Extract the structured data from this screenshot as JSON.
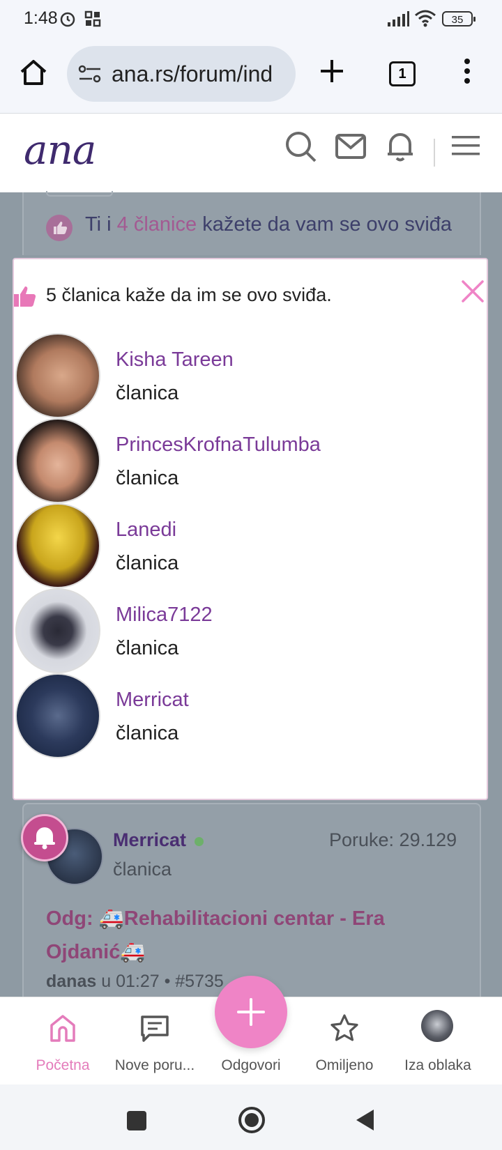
{
  "status_bar": {
    "time": "1:48",
    "battery": "35"
  },
  "browser": {
    "url": "ana.rs/forum/ind",
    "tab_count": "1"
  },
  "site": {
    "logo": "ana"
  },
  "background_post": {
    "like_prefix": "Ti i",
    "like_members": "4 članice",
    "like_suffix": "kažete da vam se ovo sviđa",
    "author": "Merricat",
    "author_role": "članica",
    "posts_label": "Poruke: 29.129",
    "title_line1": "Odg: 🚑Rehabilitacioni centar - Era",
    "title_line2": "Ojdanić🚑",
    "meta_day": "danas",
    "meta_time": "u 01:27 •",
    "post_number": "#5735"
  },
  "modal": {
    "title": "5 članica kaže da im se ovo sviđa.",
    "members": [
      {
        "name": "Kisha Tareen",
        "role": "članica"
      },
      {
        "name": "PrincesKrofnaTulumba",
        "role": "članica"
      },
      {
        "name": "Lanedi",
        "role": "članica"
      },
      {
        "name": "Milica7122",
        "role": "članica"
      },
      {
        "name": "Merricat",
        "role": "članica"
      }
    ]
  },
  "bottom_nav": {
    "home": "Početna",
    "new_posts": "Nove poru...",
    "reply": "Odgovori",
    "favorites": "Omiljeno",
    "backstage": "Iza oblaka"
  },
  "colors": {
    "accent_pink": "#ef84c6",
    "member_purple": "#7a3a98",
    "logo_purple": "#3f2a6e"
  }
}
